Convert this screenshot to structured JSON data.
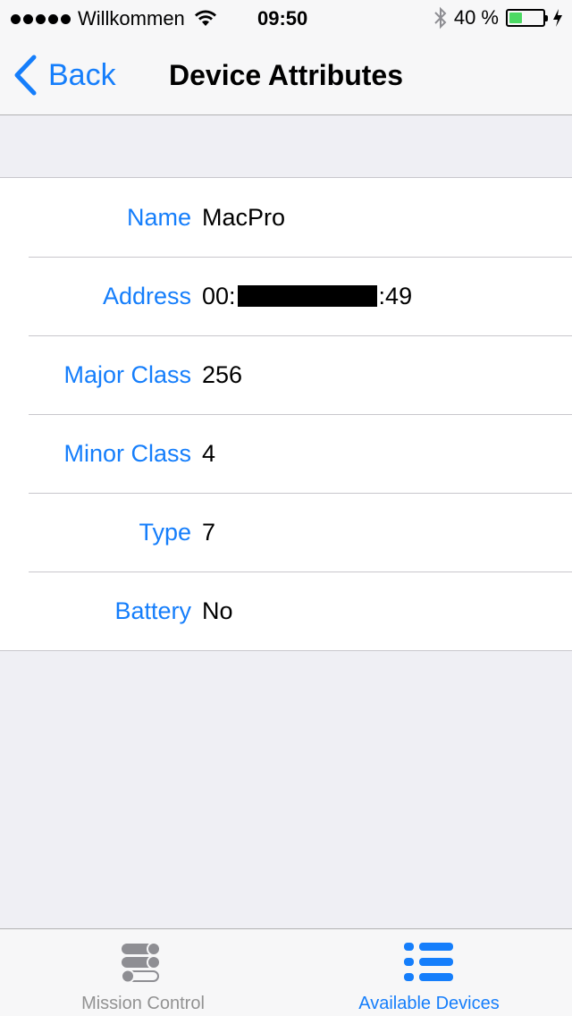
{
  "status_bar": {
    "carrier": "Willkommen",
    "time": "09:50",
    "battery_percent_text": "40 %",
    "battery_level": 0.4,
    "icons": [
      "signal-dots-icon",
      "wifi-icon",
      "bluetooth-icon",
      "battery-icon",
      "charging-bolt-icon"
    ]
  },
  "nav": {
    "back_label": "Back",
    "title": "Device Attributes"
  },
  "attributes": [
    {
      "key": "Name",
      "value": "MacPro"
    },
    {
      "key": "Address",
      "value_prefix": "00:",
      "value_suffix": ":49"
    },
    {
      "key": "Major Class",
      "value": "256"
    },
    {
      "key": "Minor Class",
      "value": "4"
    },
    {
      "key": "Type",
      "value": "7"
    },
    {
      "key": "Battery",
      "value": "No"
    }
  ],
  "tabs": [
    {
      "label": "Mission Control",
      "icon": "toggles-icon",
      "active": false
    },
    {
      "label": "Available Devices",
      "icon": "list-icon",
      "active": true
    }
  ],
  "colors": {
    "accent": "#157efb",
    "battery_fill": "#4cd964",
    "background": "#efeff4"
  }
}
